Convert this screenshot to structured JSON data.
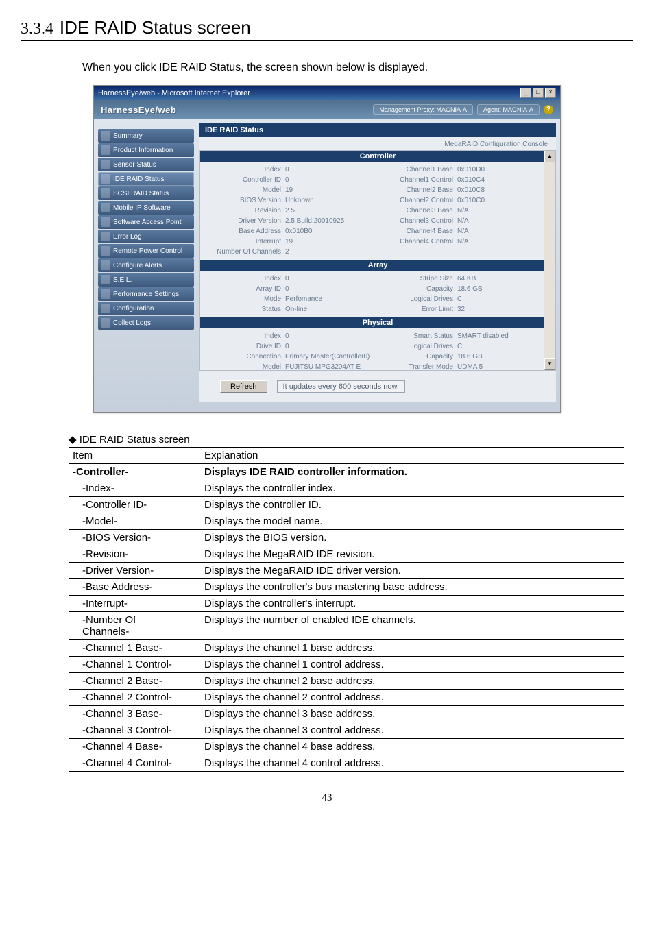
{
  "section": {
    "number": "3.3.4",
    "title": "IDE RAID Status screen"
  },
  "intro": "When you click IDE RAID Status, the screen shown below is displayed.",
  "window": {
    "title": "HarnessEye/web - Microsoft Internet Explorer",
    "logo": "HarnessEye/web",
    "proxy": "Management Proxy: MAGNIA-A",
    "agent": "Agent: MAGNIA-A"
  },
  "nav": [
    "Summary",
    "Product Information",
    "Sensor Status",
    "IDE RAID Status",
    "SCSI RAID Status",
    "Mobile IP Software",
    "Software Access Point",
    "Error Log",
    "Remote Power Control",
    "Configure Alerts",
    "S.E.L.",
    "Performance Settings",
    "Configuration",
    "Collect Logs"
  ],
  "panel": {
    "title": "IDE RAID Status",
    "rightnote": "MegaRAID Configuration Console",
    "sections": {
      "controller_label": "Controller",
      "array_label": "Array",
      "physical_label": "Physical"
    },
    "controller_left": [
      {
        "k": "Index",
        "v": "0"
      },
      {
        "k": "Controller ID",
        "v": "0"
      },
      {
        "k": "Model",
        "v": "19"
      },
      {
        "k": "BIOS Version",
        "v": "Unknown"
      },
      {
        "k": "Revision",
        "v": "2.5"
      },
      {
        "k": "Driver Version",
        "v": "2.5 Build:20010925"
      },
      {
        "k": "Base Address",
        "v": "0x010B0"
      },
      {
        "k": "Interrupt",
        "v": "19"
      },
      {
        "k": "Number Of Channels",
        "v": "2"
      }
    ],
    "controller_right": [
      {
        "k": "Channel1 Base",
        "v": "0x010D0"
      },
      {
        "k": "Channel1 Control",
        "v": "0x010C4"
      },
      {
        "k": "Channel2 Base",
        "v": "0x010C8"
      },
      {
        "k": "Channel2 Control",
        "v": "0x010C0"
      },
      {
        "k": "Channel3 Base",
        "v": "N/A"
      },
      {
        "k": "Channel3 Control",
        "v": "N/A"
      },
      {
        "k": "Channel4 Base",
        "v": "N/A"
      },
      {
        "k": "Channel4 Control",
        "v": "N/A"
      }
    ],
    "array_left": [
      {
        "k": "Index",
        "v": "0"
      },
      {
        "k": "Array ID",
        "v": "0"
      },
      {
        "k": "Mode",
        "v": "Perfomance"
      },
      {
        "k": "Status",
        "v": "On-line"
      }
    ],
    "array_right": [
      {
        "k": "Stripe Size",
        "v": "64 KB"
      },
      {
        "k": "Capacity",
        "v": "18.6 GB"
      },
      {
        "k": "Logical Drives",
        "v": "C"
      },
      {
        "k": "Error Limit",
        "v": "32"
      }
    ],
    "physical_left": [
      {
        "k": "Index",
        "v": "0"
      },
      {
        "k": "Drive ID",
        "v": "0"
      },
      {
        "k": "Connection",
        "v": "Primary Master(Controller0)"
      },
      {
        "k": "Model",
        "v": "FUJITSU MPG3204AT E"
      }
    ],
    "physical_right": [
      {
        "k": "Smart Status",
        "v": "SMART disabled"
      },
      {
        "k": "Logical Drives",
        "v": "C"
      },
      {
        "k": "Capacity",
        "v": "18.6 GB"
      },
      {
        "k": "Transfer Mode",
        "v": "UDMA 5"
      }
    ],
    "refresh_label": "Refresh",
    "refresh_note": "It updates every 600 seconds now."
  },
  "subheading": "◆ IDE RAID Status screen",
  "table": {
    "headers": [
      "Item",
      "Explanation"
    ],
    "rows": [
      {
        "item": "-Controller-",
        "exp": "Displays IDE RAID controller information.",
        "bold": true
      },
      {
        "item": "-Index-",
        "exp": "Displays the controller index.",
        "indent": 1
      },
      {
        "item": "-Controller ID-",
        "exp": "Displays the controller ID.",
        "indent": 1
      },
      {
        "item": "-Model-",
        "exp": "Displays the model name.",
        "indent": 1
      },
      {
        "item": "-BIOS Version-",
        "exp": "Displays the BIOS version.",
        "indent": 1
      },
      {
        "item": "-Revision-",
        "exp": "Displays the MegaRAID IDE revision.",
        "indent": 1
      },
      {
        "item": "-Driver Version-",
        "exp": "Displays the MegaRAID IDE driver version.",
        "indent": 1
      },
      {
        "item": "-Base Address-",
        "exp": "Displays the controller's bus mastering base address.",
        "indent": 1
      },
      {
        "item": "-Interrupt-",
        "exp": "Displays the controller's interrupt.",
        "indent": 1
      },
      {
        "item": "-Number Of\n   Channels-",
        "exp": "Displays the number of enabled IDE channels.",
        "indent": 1
      },
      {
        "item": "-Channel 1 Base-",
        "exp": "Displays the channel 1 base address.",
        "indent": 1
      },
      {
        "item": "-Channel 1 Control-",
        "exp": "Displays the channel 1 control address.",
        "indent": 1
      },
      {
        "item": "-Channel 2 Base-",
        "exp": "Displays the channel 2 base address.",
        "indent": 1
      },
      {
        "item": "-Channel 2 Control-",
        "exp": "Displays the channel 2 control address.",
        "indent": 1
      },
      {
        "item": "-Channel 3 Base-",
        "exp": "Displays the channel 3 base address.",
        "indent": 1
      },
      {
        "item": "-Channel 3 Control-",
        "exp": "Displays the channel 3 control address.",
        "indent": 1
      },
      {
        "item": "-Channel 4 Base-",
        "exp": "Displays the channel 4 base address.",
        "indent": 1
      },
      {
        "item": "-Channel 4 Control-",
        "exp": "Displays the channel 4 control address.",
        "indent": 1
      }
    ]
  },
  "page_number": "43"
}
